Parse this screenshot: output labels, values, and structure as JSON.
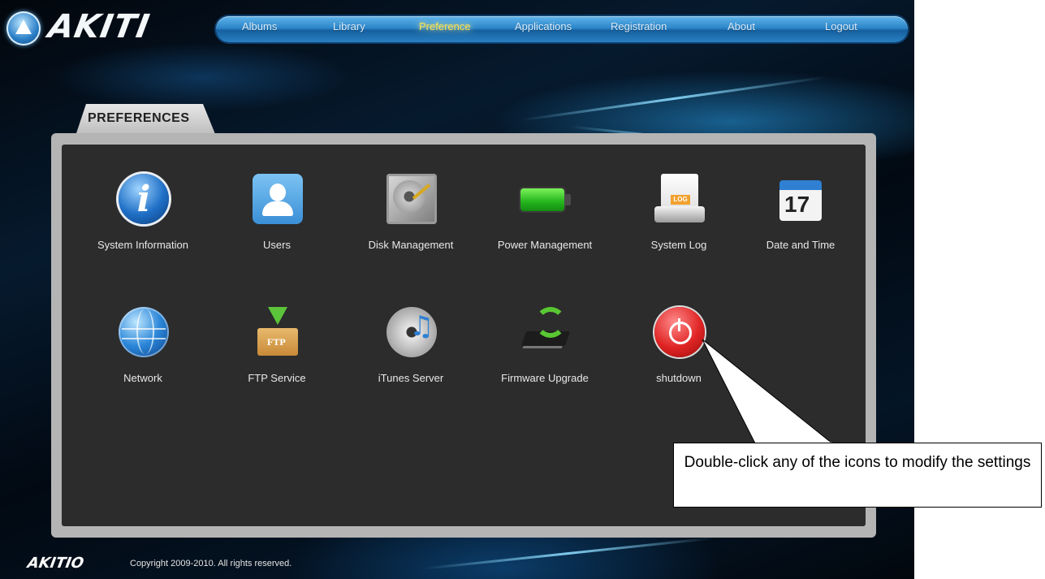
{
  "brand": {
    "logo_text": "AKITI",
    "footer_logo": "AKITIO"
  },
  "nav": {
    "items": [
      {
        "label": "Albums"
      },
      {
        "label": "Library"
      },
      {
        "label": "Preference",
        "active": true
      },
      {
        "label": "Applications"
      },
      {
        "label": "Registration"
      },
      {
        "label": "About"
      },
      {
        "label": "Logout"
      }
    ]
  },
  "panel": {
    "tab_label": "PREFERENCES",
    "tiles": [
      {
        "label": "System Information",
        "icon": "info-icon"
      },
      {
        "label": "Users",
        "icon": "users-icon"
      },
      {
        "label": "Disk Management",
        "icon": "hard-disk-icon"
      },
      {
        "label": "Power Management",
        "icon": "battery-icon"
      },
      {
        "label": "System Log",
        "icon": "log-drive-icon",
        "badge": "LOG"
      },
      {
        "label": "Date and Time",
        "icon": "calendar-icon",
        "badge": "17"
      },
      {
        "label": "Network",
        "icon": "globe-icon"
      },
      {
        "label": "FTP Service",
        "icon": "ftp-box-icon",
        "badge": "FTP"
      },
      {
        "label": "iTunes Server",
        "icon": "itunes-cd-icon"
      },
      {
        "label": "Firmware Upgrade",
        "icon": "firmware-chip-icon"
      },
      {
        "label": "shutdown",
        "icon": "power-icon"
      }
    ]
  },
  "footer": {
    "copyright": "Copyright 2009-2010. All rights reserved."
  },
  "callout": {
    "text": "Double-click any of the icons to modify the settings"
  },
  "colors": {
    "accent": "#2d86c9",
    "active_nav": "#ffe14a",
    "panel_bg": "#2c2c2c",
    "panel_frame": "#b4b4b4"
  }
}
